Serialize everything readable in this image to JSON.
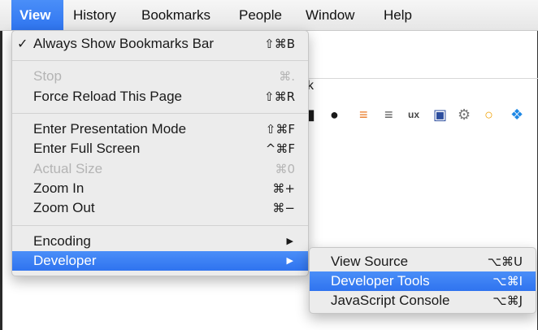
{
  "menubar": {
    "items": [
      "View",
      "History",
      "Bookmarks",
      "People",
      "Window",
      "Help"
    ]
  },
  "view_menu": {
    "always_show_bookmarks": {
      "check": "✓",
      "label": "Always Show Bookmarks Bar",
      "shortcut": "⇧⌘B"
    },
    "stop": {
      "label": "Stop",
      "shortcut": "⌘."
    },
    "force_reload": {
      "label": "Force Reload This Page",
      "shortcut": "⇧⌘R"
    },
    "presentation": {
      "label": "Enter Presentation Mode",
      "shortcut": "⇧⌘F"
    },
    "full_screen": {
      "label": "Enter Full Screen",
      "shortcut": "^⌘F"
    },
    "actual_size": {
      "label": "Actual Size",
      "shortcut": "⌘0"
    },
    "zoom_in": {
      "label": "Zoom In",
      "shortcut": "⌘+"
    },
    "zoom_out": {
      "label": "Zoom Out",
      "shortcut": "⌘−"
    },
    "encoding": {
      "label": "Encoding"
    },
    "developer": {
      "label": "Developer"
    }
  },
  "developer_submenu": {
    "view_source": {
      "label": "View Source",
      "shortcut": "⌥⌘U"
    },
    "developer_tools": {
      "label": "Developer Tools",
      "shortcut": "⌥⌘I"
    },
    "javascript_console": {
      "label": "JavaScript Console",
      "shortcut": "⌥⌘J"
    }
  },
  "background": {
    "bookmark_icons": [
      "github-icon",
      "stack-overflow-icon",
      "stack-exchange-icon",
      "ux-icon",
      "bookmark-icon",
      "gear-icon",
      "circle-icon",
      "windows-icon"
    ],
    "bookmark_glyphs": [
      "■",
      "●",
      "≡",
      "≡",
      "ux",
      "▣",
      "⚙",
      "○",
      "❖"
    ],
    "colors": {
      "accent": "#3b82f6",
      "menu_bg": "#ececec",
      "disabled": "#b4b4b4"
    }
  }
}
